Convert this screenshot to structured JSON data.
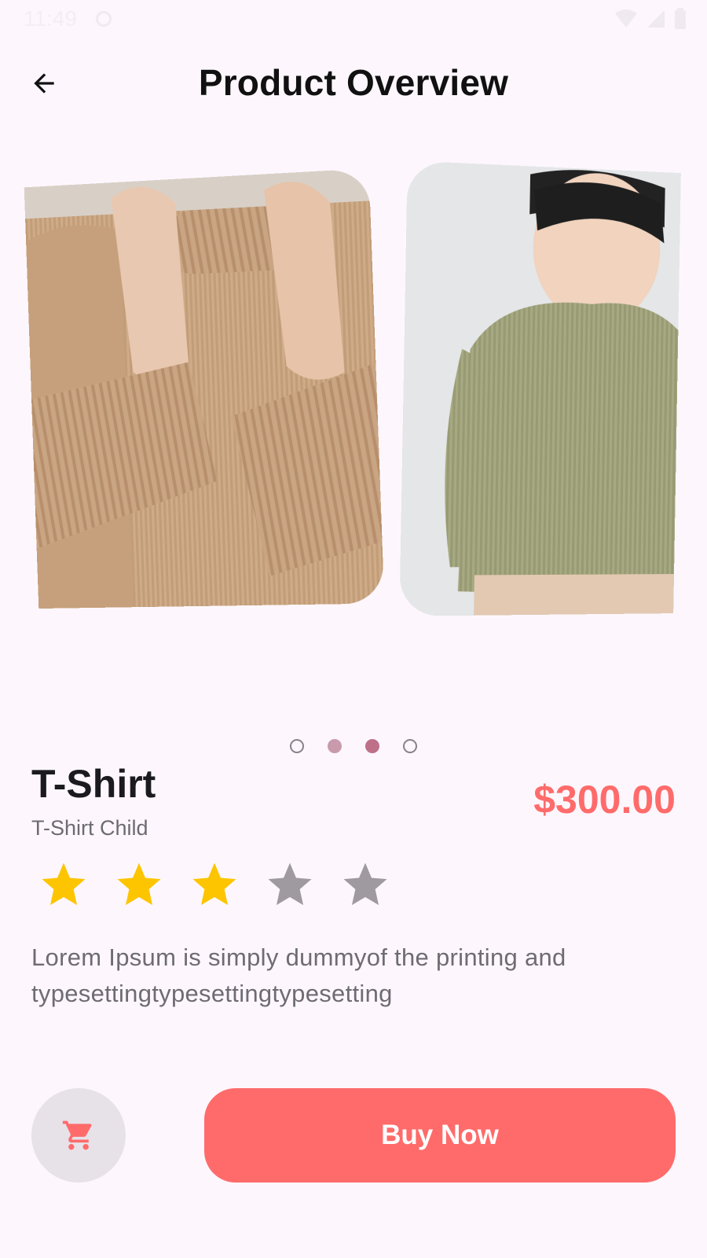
{
  "status_bar": {
    "time": "11:49"
  },
  "header": {
    "title": "Product Overview",
    "back_icon": "arrow-left-icon"
  },
  "carousel": {
    "slides": [
      {
        "alt": "beige turtleneck sweater"
      },
      {
        "alt": "child in green sweater"
      }
    ],
    "pages": 4,
    "active_index": 2
  },
  "product": {
    "name": "T-Shirt",
    "subtitle": "T-Shirt Child",
    "price": "$300.00",
    "rating": 3,
    "rating_max": 5,
    "description": "Lorem Ipsum is simply dummyof the printing and typesettingtypesettingtypesetting"
  },
  "actions": {
    "cart_icon": "cart-icon",
    "buy_label": "Buy Now"
  },
  "colors": {
    "accent": "#ff6b6b",
    "star_on": "#fdc500",
    "star_off": "#9e9aa0",
    "background": "#fdf7fd"
  }
}
